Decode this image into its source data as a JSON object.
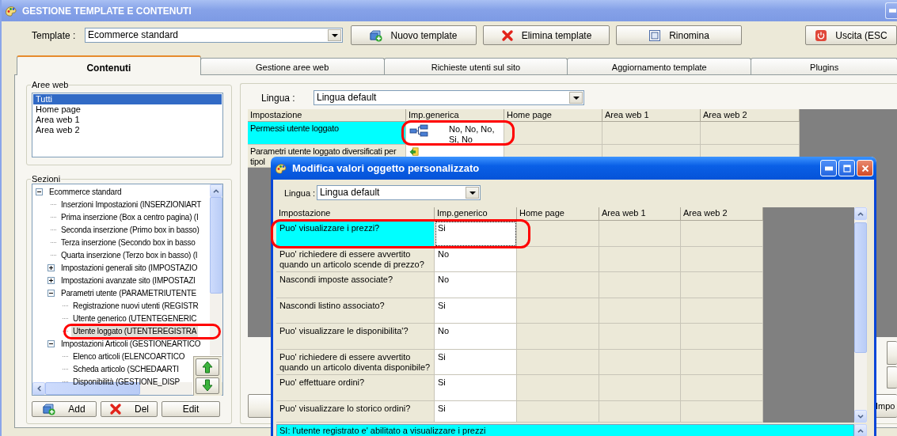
{
  "window": {
    "title": "GESTIONE TEMPLATE E CONTENUTI"
  },
  "toolbar": {
    "template_label": "Template :",
    "template_value": "Ecommerce standard",
    "buttons": [
      {
        "label": "Nuovo template",
        "kind": "new"
      },
      {
        "label": "Elimina template",
        "kind": "delete"
      },
      {
        "label": "Rinomina",
        "kind": "rename"
      },
      {
        "label": "Uscita (ESC",
        "kind": "exit"
      }
    ]
  },
  "tabs": [
    {
      "label": "Contenuti",
      "selected": true
    },
    {
      "label": "Gestione aree web",
      "selected": false
    },
    {
      "label": "Richieste utenti sul sito",
      "selected": false
    },
    {
      "label": "Aggiornamento template",
      "selected": false
    },
    {
      "label": "Plugins",
      "selected": false
    }
  ],
  "aree_web": {
    "title": "Aree web",
    "items": [
      {
        "label": "Tutti",
        "selected": true
      },
      {
        "label": "Home page",
        "selected": false
      },
      {
        "label": "Area web 1",
        "selected": false
      },
      {
        "label": "Area web 2",
        "selected": false
      }
    ]
  },
  "sezioni": {
    "title": "Sezioni",
    "tree": [
      {
        "label": "Ecommerce standard",
        "expanded": true,
        "selected": false,
        "circled": false,
        "children": [
          {
            "label": "Inserzioni Impostazioni (INSERZIONIART",
            "selected": false,
            "circled": false
          },
          {
            "label": "Prima inserzione (Box a centro pagina) (I",
            "selected": false,
            "circled": false
          },
          {
            "label": "Seconda inserzione (Primo box in basso)",
            "selected": false,
            "circled": false
          },
          {
            "label": "Terza inserzione (Secondo box in basso",
            "selected": false,
            "circled": false
          },
          {
            "label": "Quarta inserzione (Terzo box in basso) (I",
            "selected": false,
            "circled": false
          },
          {
            "label": "Impostazioni generali sito (IMPOSTAZIO",
            "expanded": false,
            "selected": false,
            "circled": false
          },
          {
            "label": "Impostazioni avanzate sito (IMPOSTAZI",
            "expanded": false,
            "selected": false,
            "circled": false
          },
          {
            "label": "Parametri utente (PARAMETRIUTENTE",
            "expanded": true,
            "selected": false,
            "circled": false,
            "children": [
              {
                "label": "Registrazione nuovi utenti (REGISTR",
                "selected": false,
                "circled": false
              },
              {
                "label": "Utente generico (UTENTEGENERIC",
                "selected": false,
                "circled": false
              },
              {
                "label": "Utente loggato (UTENTEREGISTRA",
                "selected": true,
                "circled": true
              }
            ]
          },
          {
            "label": "Impostazioni Articoli (GESTIONEARTICO",
            "expanded": true,
            "selected": false,
            "circled": false,
            "children": [
              {
                "label": "Elenco articoli (ELENCOARTICO",
                "selected": false,
                "circled": false
              },
              {
                "label": "Scheda articolo (SCHEDAARTI",
                "selected": false,
                "circled": false
              },
              {
                "label": "Disponibilità (GESTIONE_DISP",
                "selected": false,
                "circled": false
              }
            ]
          }
        ]
      }
    ],
    "buttons": [
      {
        "label": "Add",
        "kind": "new"
      },
      {
        "label": "Del",
        "kind": "delete"
      },
      {
        "label": "Edit",
        "kind": "plain"
      }
    ]
  },
  "settings": {
    "lingua_label": "Lingua :",
    "lingua_value": "Lingua default",
    "columns": [
      "Impostazione",
      "Imp.generica",
      "Home page",
      "Area web 1",
      "Area web 2"
    ],
    "rows": [
      {
        "setting": "Permessi utente loggato",
        "value": "No, No, No, Si, No",
        "kind": "hierarchy",
        "selected": true,
        "circled": true
      },
      {
        "setting": "Parametri utente loggato diversificati per tipol",
        "kind": "sync",
        "selected": false,
        "circled": false
      }
    ],
    "buttons": [
      {
        "label": "Impo"
      }
    ]
  },
  "dialog": {
    "title": "Modifica valori oggetto personalizzato",
    "lingua_label": "Lingua :",
    "lingua_value": "Lingua default",
    "columns": [
      "Impostazione",
      "Imp.generico",
      "Home page",
      "Area web 1",
      "Area web 2"
    ],
    "rows": [
      {
        "setting": "Puo' visualizzare i prezzi?",
        "value": "Si",
        "selected": true,
        "circled": true
      },
      {
        "setting": "Puo' richiedere di essere avvertito quando un articolo scende di prezzo?",
        "value": "No",
        "selected": false,
        "circled": false
      },
      {
        "setting": "Nascondi imposte associate?",
        "value": "No",
        "selected": false,
        "circled": false
      },
      {
        "setting": "Nascondi listino associato?",
        "value": "Si",
        "selected": false,
        "circled": false
      },
      {
        "setting": "Puo' visualizzare le disponibilita'?",
        "value": "No",
        "selected": false,
        "circled": false
      },
      {
        "setting": "Puo' richiedere di essere avvertito quando un articolo diventa disponibile?",
        "value": "Si",
        "selected": false,
        "circled": false
      },
      {
        "setting": "Puo' effettuare ordini?",
        "value": "Si",
        "selected": false,
        "circled": false
      },
      {
        "setting": "Puo' visualizzare lo storico ordini?",
        "value": "Si",
        "selected": false,
        "circled": false
      }
    ],
    "description": "SI: l'utente registrato e' abilitato a visualizzare i prezzi"
  }
}
